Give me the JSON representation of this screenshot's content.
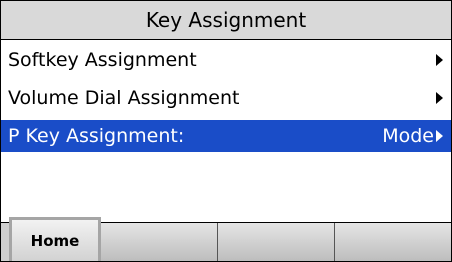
{
  "header": {
    "title": "Key Assignment"
  },
  "menu": {
    "items": [
      {
        "label": "Softkey Assignment",
        "value": ""
      },
      {
        "label": "Volume Dial Assignment",
        "value": ""
      },
      {
        "label": "P Key Assignment:",
        "value": "Mode"
      }
    ]
  },
  "softkeys": {
    "labels": [
      "Home",
      "",
      "",
      ""
    ]
  },
  "colors": {
    "highlight": "#1a4dc8",
    "title_bar": "#d9d9d9"
  }
}
